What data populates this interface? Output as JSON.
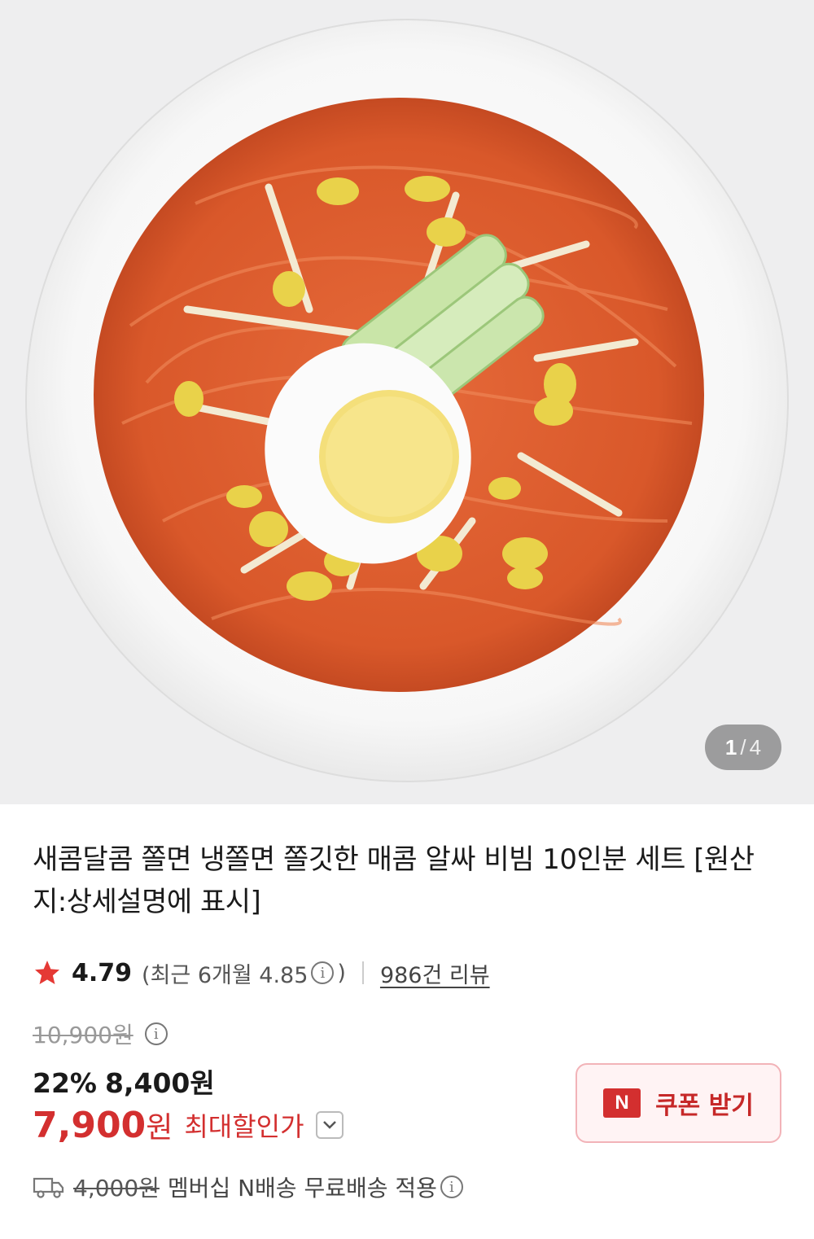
{
  "gallery": {
    "current": "1",
    "separator": "/",
    "total": "4"
  },
  "product": {
    "title": "새콤달콤 쫄면 냉쫄면 쫄깃한 매콤 알싸 비빔 10인분 세트 [원산지:상세설명에 표시]"
  },
  "rating": {
    "score": "4.79",
    "recent_prefix": "(최근 6개월 4.85",
    "recent_suffix": ")",
    "info_icon": "i",
    "reviews": "986건 리뷰"
  },
  "price": {
    "original": "10,900원",
    "discount_rate": "22%",
    "discount_price": "8,400원",
    "final_price": "7,900",
    "final_unit": "원",
    "final_label": "최대할인가"
  },
  "coupon": {
    "badge": "N",
    "label": "쿠폰 받기"
  },
  "shipping": {
    "original_fee": "4,000원",
    "text": "멤버십 N배송 무료배송 적용"
  },
  "colors": {
    "accent_red": "#d32f2f",
    "coupon_bg": "#fff3f4",
    "star": "#e53935"
  }
}
